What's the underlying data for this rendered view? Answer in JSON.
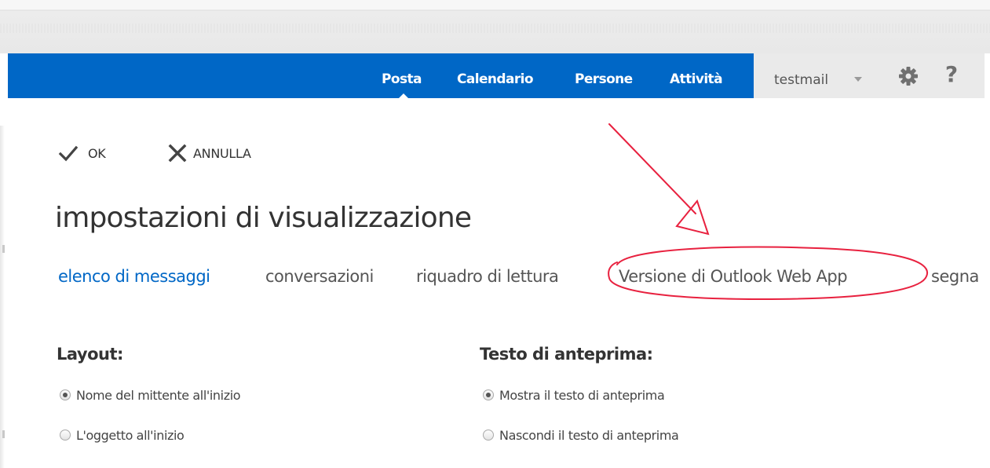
{
  "nav": {
    "tabs": [
      {
        "label": "Posta",
        "active": true
      },
      {
        "label": "Calendario",
        "active": false
      },
      {
        "label": "Persone",
        "active": false
      },
      {
        "label": "Attività",
        "active": false
      }
    ],
    "user": "testmail",
    "settings_icon": "gear-icon",
    "help_label": "?"
  },
  "commands": {
    "ok_label": "OK",
    "ok_icon": "checkmark-icon",
    "cancel_label": "ANNULLA",
    "cancel_icon": "close-icon"
  },
  "page": {
    "title": "impostazioni di visualizzazione"
  },
  "subtabs": [
    {
      "label": "elenco di messaggi",
      "active": true
    },
    {
      "label": "conversazioni",
      "active": false
    },
    {
      "label": "riquadro di lettura",
      "active": false
    },
    {
      "label": "Versione di Outlook Web App",
      "active": false
    },
    {
      "label": "segna",
      "active": false
    }
  ],
  "layout_section": {
    "heading": "Layout:",
    "options": [
      {
        "label": "Nome del mittente all'inizio",
        "checked": true
      },
      {
        "label": "L'oggetto all'inizio",
        "checked": false
      }
    ]
  },
  "preview_section": {
    "heading": "Testo di anteprima:",
    "options": [
      {
        "label": "Mostra il testo di anteprima",
        "checked": true
      },
      {
        "label": "Nascondi il testo di anteprima",
        "checked": false
      }
    ]
  },
  "colors": {
    "brand_blue": "#0067c6",
    "annotation_red": "#e8213f",
    "active_link": "#0067c6"
  }
}
